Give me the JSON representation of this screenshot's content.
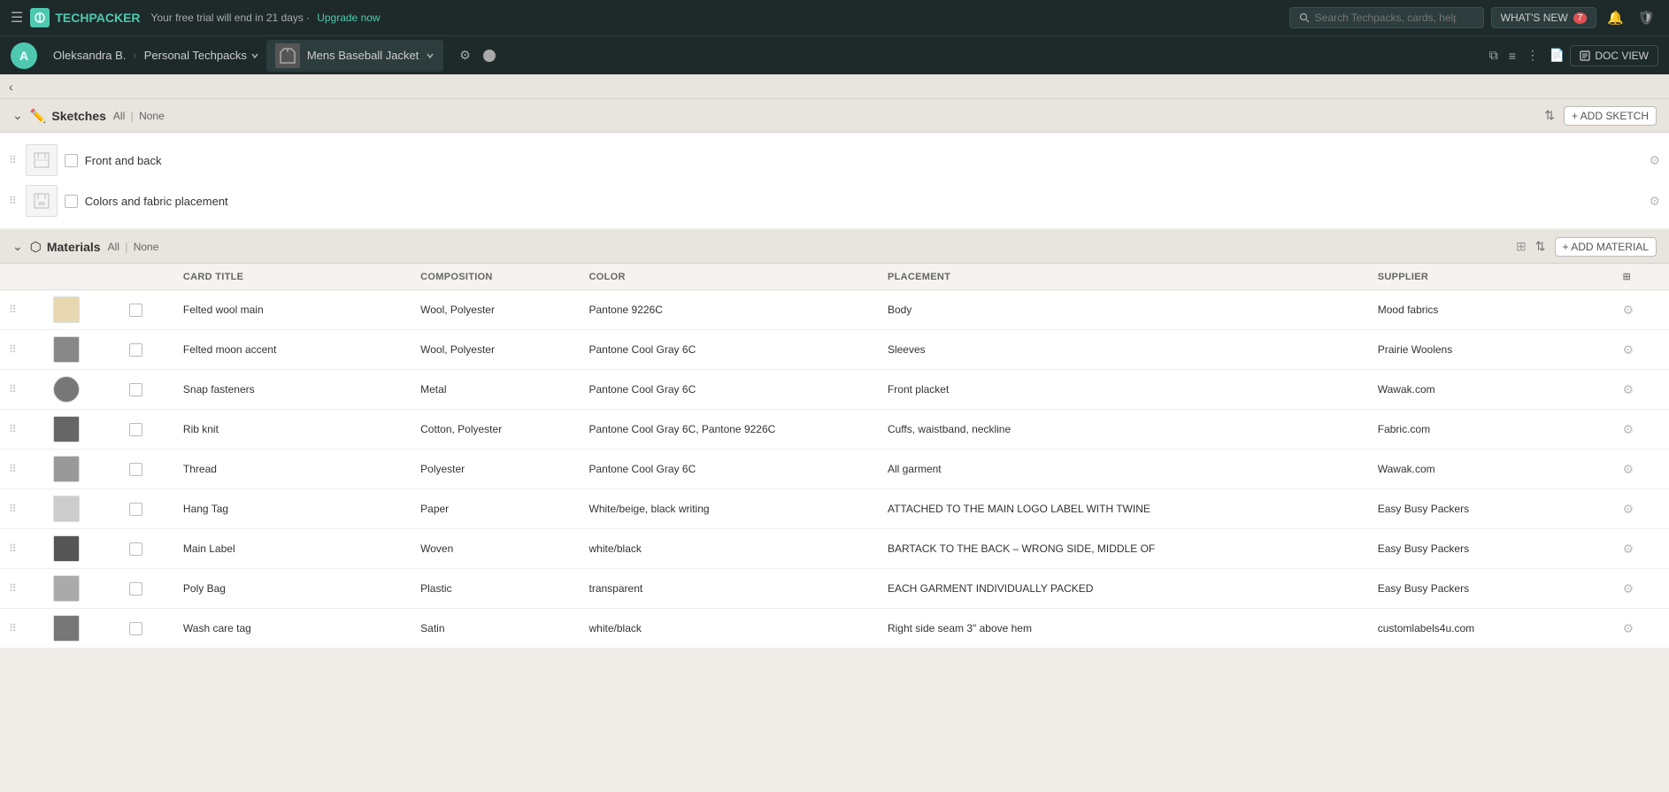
{
  "topNav": {
    "hamburger": "☰",
    "logoText": "TECHPACKER",
    "trialText": "Your free trial will end in 21 days ·",
    "upgradeLabel": "Upgrade now",
    "searchPlaceholder": "Search Techpacks, cards, help...",
    "whatsNew": "WHAT'S NEW",
    "whatsNewBadge": "7",
    "icons": [
      "🔔",
      "🛡"
    ]
  },
  "secondNav": {
    "avatarLetter": "A",
    "breadcrumb1": "Oleksandra B.",
    "breadcrumb2": "Personal Techpacks",
    "productName": "Mens Baseball Jacket",
    "statusDot": "",
    "rightIcons": [
      "copy",
      "filter",
      "more",
      "file",
      "doc-view"
    ],
    "docViewLabel": "DOC VIEW"
  },
  "sketches": {
    "sectionTitle": "Sketches",
    "filterAll": "All",
    "filterNone": "None",
    "addLabel": "+ ADD SKETCH",
    "items": [
      {
        "name": "Front and back",
        "id": "sketch-1"
      },
      {
        "name": "Colors and fabric placement",
        "id": "sketch-2"
      }
    ]
  },
  "materials": {
    "sectionTitle": "Materials",
    "filterAll": "All",
    "filterNone": "None",
    "addLabel": "+ ADD MATERIAL",
    "columns": {
      "cardTitle": "Card Title",
      "composition": "Composition",
      "color": "Color",
      "placement": "Placement",
      "supplier": "Supplier"
    },
    "rows": [
      {
        "name": "Felted wool main",
        "composition": "Wool, Polyester",
        "color": "Pantone 9226C",
        "placement": "Body",
        "supplier": "Mood fabrics",
        "thumbClass": "mat-thumb-felted-main"
      },
      {
        "name": "Felted moon accent",
        "composition": "Wool, Polyester",
        "color": "Pantone Cool Gray 6C",
        "placement": "Sleeves",
        "supplier": "Prairie Woolens",
        "thumbClass": "mat-thumb-felted-accent"
      },
      {
        "name": "Snap fasteners",
        "composition": "Metal",
        "color": "Pantone Cool Gray 6C",
        "placement": "Front placket",
        "supplier": "Wawak.com",
        "thumbClass": "mat-thumb-snap"
      },
      {
        "name": "Rib knit",
        "composition": "Cotton, Polyester",
        "color": "Pantone Cool Gray 6C, Pantone 9226C",
        "placement": "Cuffs, waistband, neckline",
        "supplier": "Fabric.com",
        "thumbClass": "mat-thumb-rib"
      },
      {
        "name": "Thread",
        "composition": "Polyester",
        "color": "Pantone Cool Gray 6C",
        "placement": "All garment",
        "supplier": "Wawak.com",
        "thumbClass": "mat-thumb-thread"
      },
      {
        "name": "Hang Tag",
        "composition": "Paper",
        "color": "White/beige, black writing",
        "placement": "ATTACHED TO THE MAIN LOGO LABEL WITH TWINE",
        "supplier": "Easy Busy Packers",
        "thumbClass": "mat-thumb-hang"
      },
      {
        "name": "Main Label",
        "composition": "Woven",
        "color": "white/black",
        "placement": "BARTACK TO THE BACK – WRONG SIDE, MIDDLE OF",
        "supplier": "Easy Busy Packers",
        "thumbClass": "mat-thumb-label"
      },
      {
        "name": "Poly Bag",
        "composition": "Plastic",
        "color": "transparent",
        "placement": "EACH GARMENT INDIVIDUALLY PACKED",
        "supplier": "Easy Busy Packers",
        "thumbClass": "mat-thumb-poly"
      },
      {
        "name": "Wash care tag",
        "composition": "Satin",
        "color": "white/black",
        "placement": "Right side seam 3\" above hem",
        "supplier": "customlabels4u.com",
        "thumbClass": "mat-thumb-care"
      }
    ]
  }
}
